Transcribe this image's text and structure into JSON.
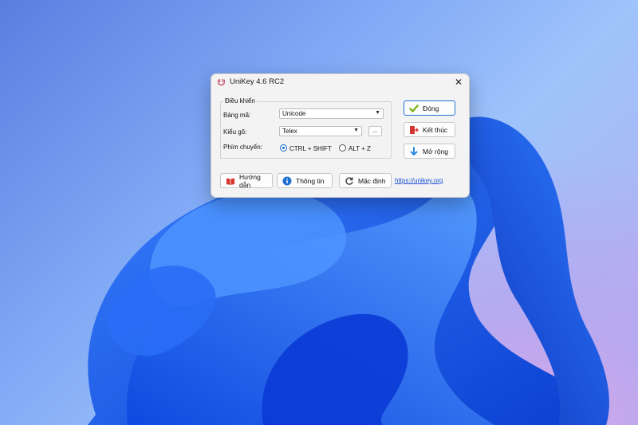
{
  "window": {
    "title": "UniKey 4.6 RC2",
    "close_glyph": "✕"
  },
  "group": {
    "title": "Điều khiển",
    "charset_label": "Bảng mã:",
    "charset_value": "Unicode",
    "input_label": "Kiểu gõ:",
    "input_value": "Telex",
    "more_label": "...",
    "switch_label": "Phím chuyển:",
    "switch_options": [
      {
        "label": "CTRL + SHIFT",
        "selected": true
      },
      {
        "label": "ALT + Z",
        "selected": false
      }
    ]
  },
  "side_buttons": {
    "close": "Đóng",
    "exit": "Kết thúc",
    "expand": "Mở rộng"
  },
  "bottom_buttons": {
    "guide": "Hướng dẫn",
    "info": "Thông tin",
    "default": "Mặc định"
  },
  "link": "https://unikey.org",
  "colors": {
    "accent": "#1f6fd0",
    "link": "#1a4fd6",
    "wallpaper_blue": "#1f5ff0"
  }
}
